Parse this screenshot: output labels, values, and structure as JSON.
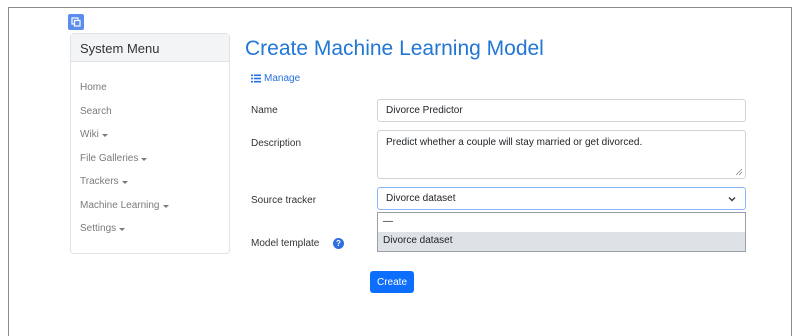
{
  "sidebar": {
    "title": "System Menu",
    "items": [
      {
        "label": "Home",
        "has_dropdown": false
      },
      {
        "label": "Search",
        "has_dropdown": false
      },
      {
        "label": "Wiki",
        "has_dropdown": true
      },
      {
        "label": "File Galleries",
        "has_dropdown": true
      },
      {
        "label": "Trackers",
        "has_dropdown": true
      },
      {
        "label": "Machine Learning",
        "has_dropdown": true
      },
      {
        "label": "Settings",
        "has_dropdown": true
      }
    ]
  },
  "main": {
    "title": "Create Machine Learning Model",
    "manage_link": "Manage",
    "form": {
      "name_label": "Name",
      "name_value": "Divorce Predictor",
      "description_label": "Description",
      "description_value": "Predict whether a couple will stay married or get divorced.",
      "source_tracker_label": "Source tracker",
      "source_tracker_value": "Divorce dataset",
      "source_tracker_options": [
        "—",
        "Divorce dataset"
      ],
      "model_template_label": "Model template",
      "help_glyph": "?",
      "create_button": "Create"
    }
  },
  "colors": {
    "accent": "#0d6efd",
    "title": "#2277d5",
    "link": "#2470e0",
    "selected_option_bg": "#dee1e5"
  },
  "icons": {
    "corner": "window-icon",
    "manage": "list-icon",
    "dropdown": "chevron-down-icon",
    "help": "question-circle-icon"
  }
}
